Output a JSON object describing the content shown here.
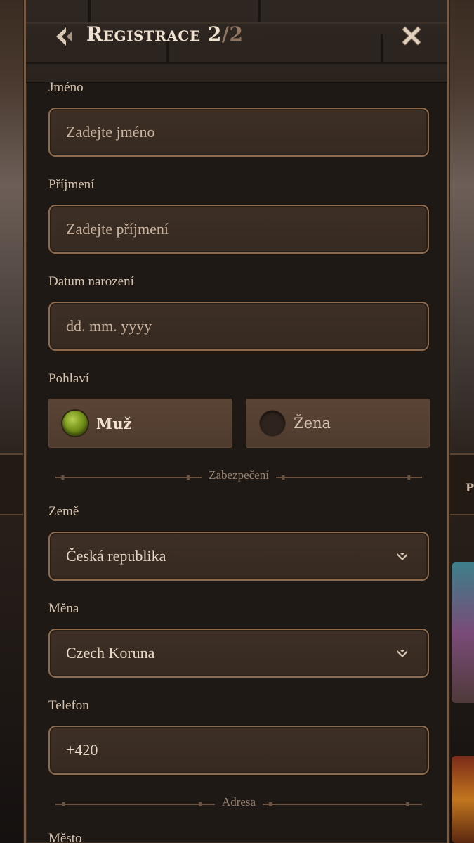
{
  "header": {
    "title_main": "Registrace 2",
    "title_total": "/2"
  },
  "form": {
    "first_name": {
      "label": "Jméno",
      "placeholder": "Zadejte jméno"
    },
    "last_name": {
      "label": "Příjmení",
      "placeholder": "Zadejte příjmení"
    },
    "birth_date": {
      "label": "Datum narození",
      "placeholder": "dd. mm. yyyy"
    },
    "gender": {
      "label": "Pohlaví",
      "options": [
        {
          "label": "Muž",
          "selected": true
        },
        {
          "label": "Žena",
          "selected": false
        }
      ]
    },
    "section_security": "Zabezpečení",
    "country": {
      "label": "Země",
      "value": "Česká republika"
    },
    "currency": {
      "label": "Měna",
      "value": "Czech Koruna"
    },
    "phone": {
      "label": "Telefon",
      "value": "+420"
    },
    "section_address": "Adresa",
    "city": {
      "label": "Město"
    }
  },
  "background": {
    "partial_text": "Po"
  },
  "colors": {
    "accent_border": "#8d6b4e",
    "selected_radio": "#7d9b1f",
    "text_primary": "#efe2d0"
  }
}
